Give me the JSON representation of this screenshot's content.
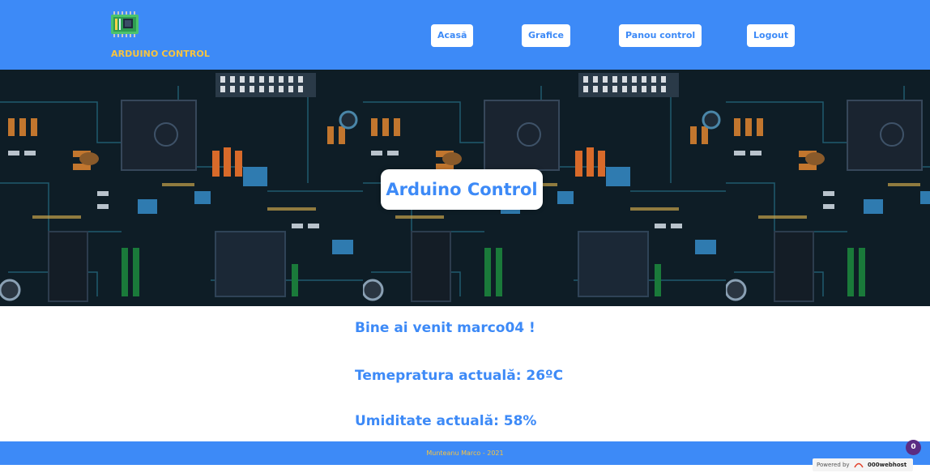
{
  "header": {
    "brand": "ARDUINO CONTROL",
    "logo_icon": "circuit-board-icon",
    "nav": [
      {
        "label": "Acasă"
      },
      {
        "label": "Grafice"
      },
      {
        "label": "Panou control"
      },
      {
        "label": "Logout"
      }
    ],
    "colors": {
      "bar": "#3d8af7",
      "brand_text": "#f7c440",
      "button_text": "#3d8af7"
    }
  },
  "hero": {
    "title": "Arduino Control",
    "background": "circuit-board-photo"
  },
  "main": {
    "welcome": "Bine ai venit marco04 !",
    "temperature": "Temepratura actuală: 26ºC",
    "humidity": "Umiditate actuală: 58%"
  },
  "footer": {
    "text": "Munteanu Marco - 2021"
  },
  "widgets": {
    "badge_count": "0",
    "powered_by_prefix": "Powered by",
    "powered_by_brand": "000webhost"
  }
}
